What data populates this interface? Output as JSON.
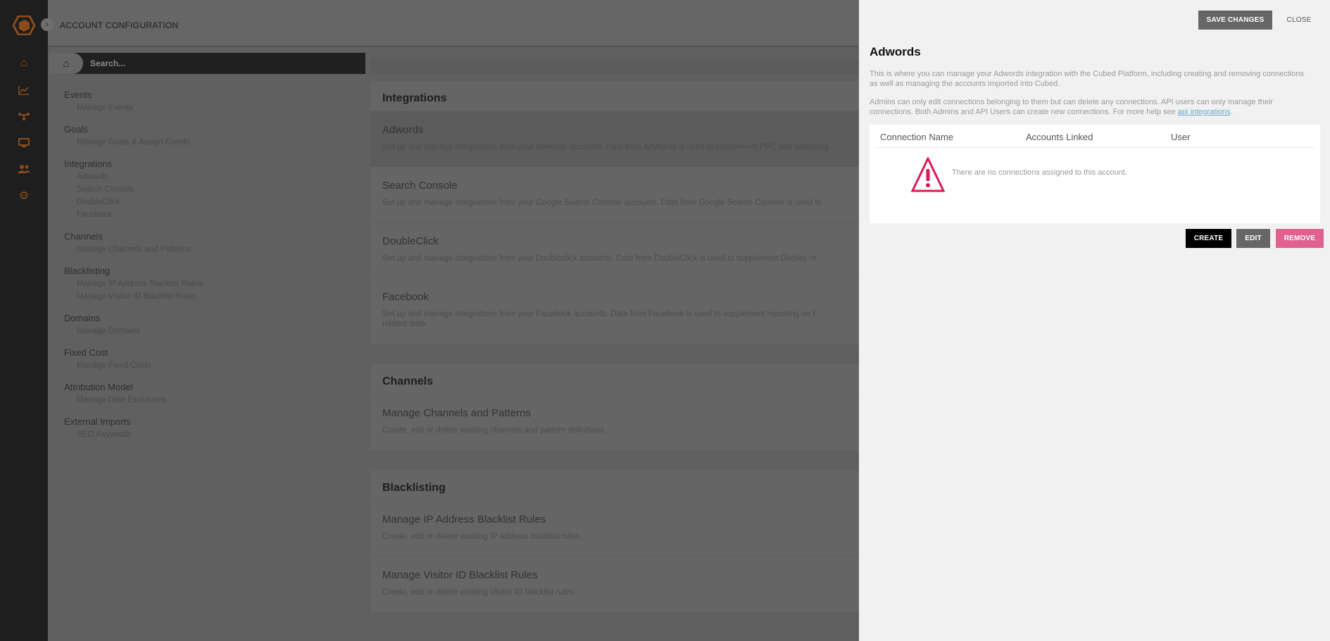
{
  "header": {
    "title": "ACCOUNT CONFIGURATION"
  },
  "rail": {
    "icons": [
      "home-icon",
      "chart-line-icon",
      "sitemap-icon",
      "monitor-icon",
      "users-icon",
      "gear-icon"
    ],
    "accent": "#8a4c1c"
  },
  "search": {
    "placeholder": "Search..."
  },
  "nav": [
    {
      "heading": "Events",
      "items": [
        "Manage Events"
      ]
    },
    {
      "heading": "Goals",
      "items": [
        "Manage Goals & Assign Events"
      ]
    },
    {
      "heading": "Integrations",
      "items": [
        "Adwords",
        "Search Console",
        "DoubleClick",
        "Facebook"
      ]
    },
    {
      "heading": "Channels",
      "items": [
        "Manage Channels and Patterns"
      ]
    },
    {
      "heading": "Blacklisting",
      "items": [
        "Manage IP Address Blacklist Rules",
        "Manage Visitor ID Blacklist Rules"
      ]
    },
    {
      "heading": "Domains",
      "items": [
        "Manage Domains"
      ]
    },
    {
      "heading": "Fixed Cost",
      "items": [
        "Manage Fixed Costs"
      ]
    },
    {
      "heading": "Attribution Model",
      "items": [
        "Manage Date Exclusions"
      ]
    },
    {
      "heading": "External Imports",
      "items": [
        "SEO Keywords"
      ]
    }
  ],
  "main": {
    "integrations": {
      "title": "Integrations",
      "rows": [
        {
          "title": "Adwords",
          "desc": "Set up and manage integrations from your Adwords accounts. Data from AdWords is used to supplement PPC and Shopping"
        },
        {
          "title": "Search Console",
          "desc": "Set up and manage integrations from your Google Search Console accounts. Data from Google Search Console is used to"
        },
        {
          "title": "DoubleClick",
          "desc": "Set up and manage integrations from your Doubleclick accounts. Data from DoubleClick is used to supplement Display re"
        },
        {
          "title": "Facebook",
          "desc": "Set up and manage integrations from your Facebook accounts. Data from Facebook is used to supplement reporting on F",
          "desc2": "related data."
        }
      ]
    },
    "channels": {
      "title": "Channels",
      "rows": [
        {
          "title": "Manage Channels and Patterns",
          "desc": "Create, edit or delete existing channels and pattern definitions."
        }
      ]
    },
    "blacklisting": {
      "title": "Blacklisting",
      "rows": [
        {
          "title": "Manage IP Address Blacklist Rules",
          "desc": "Create, edit or delete existing IP address blacklist rules."
        },
        {
          "title": "Manage Visitor ID Blacklist Rules",
          "desc": "Create, edit or delete existing Visitor ID blacklist rules."
        }
      ]
    }
  },
  "panel": {
    "save_label": "SAVE CHANGES",
    "close_label": "CLOSE",
    "title": "Adwords",
    "para1": "This is where you can manage your Adwords integration with the Cubed Platform, including creating and removing connections as well as managing the accounts imported into Cubed.",
    "para2": "Admins can only edit connections belonging to them but can delete any connections. API users can only manage their connections. Both Admins and API Users can create new connections. For more help see ",
    "link": "api integrations",
    "para2_end": ".",
    "table": {
      "columns": [
        "Connection Name",
        "Accounts Linked",
        "User"
      ],
      "empty": "There are no connections assigned to this account."
    },
    "create_label": "CREATE",
    "edit_label": "EDIT",
    "remove_label": "REMOVE",
    "colors": {
      "create": "#000000",
      "edit": "#666666",
      "remove": "#e06090",
      "warning": "#d81b55"
    }
  }
}
